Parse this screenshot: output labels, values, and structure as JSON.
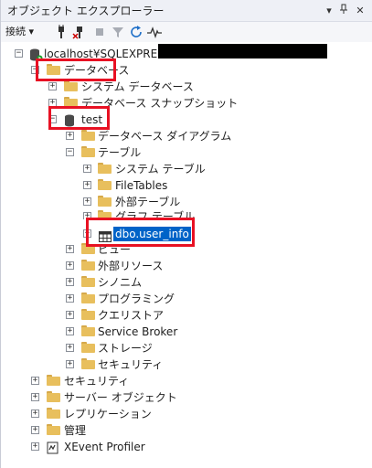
{
  "panel": {
    "title": "オブジェクト エクスプローラー",
    "pin_glyph": "▾",
    "pin_glyph2": "ꟷ",
    "close_glyph": "✕"
  },
  "toolbar": {
    "connect_label": "接続 ▾",
    "icons": [
      "connect-icon",
      "disconnect-icon",
      "stop-icon",
      "filter-icon",
      "refresh-icon",
      "activity-monitor-icon"
    ]
  },
  "tree": {
    "server": "localhost¥SQLEXPRESS",
    "databases": "データベース",
    "system_databases": "システム データベース",
    "db_snapshots": "データベース スナップショット",
    "db_test": "test",
    "db_diagrams": "データベース ダイアグラム",
    "tables": "テーブル",
    "system_tables": "システム テーブル",
    "filetables": "FileTables",
    "external_tables": "外部テーブル",
    "graph_tables": "グラフ テーブル",
    "user_info": "dbo.user_info",
    "views": "ビュー",
    "external_resources": "外部リソース",
    "synonyms": "シノニム",
    "programmability": "プログラミング",
    "query_store": "クエリストア",
    "service_broker": "Service Broker",
    "storage": "ストレージ",
    "db_security": "セキュリティ",
    "security": "セキュリティ",
    "server_objects": "サーバー オブジェクト",
    "replication": "レプリケーション",
    "management": "管理",
    "xevent_profiler": "XEvent Profiler"
  },
  "colors": {
    "highlight": "#0063c8",
    "annotation_red": "#e81123",
    "folder": "#e8bf5d"
  }
}
